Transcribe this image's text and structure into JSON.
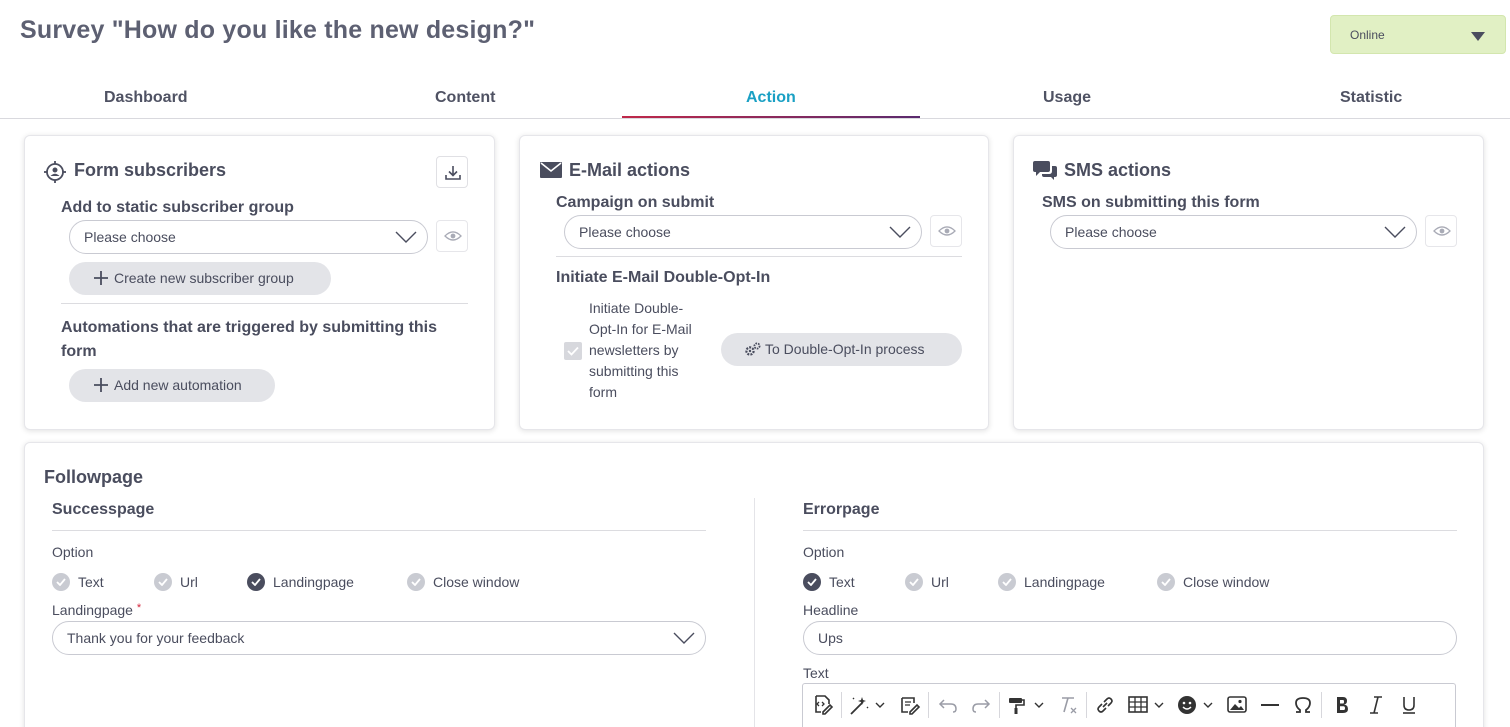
{
  "page": {
    "title": "Survey \"How do you like the new design?\""
  },
  "status": {
    "value": "Online"
  },
  "tabs": [
    {
      "label": "Dashboard"
    },
    {
      "label": "Content"
    },
    {
      "label": "Action"
    },
    {
      "label": "Usage"
    },
    {
      "label": "Statistic"
    }
  ],
  "form_subscribers": {
    "title": "Form subscribers",
    "group_label": "Add to static subscriber group",
    "group_select": "Please choose",
    "create_group_button": "Create new subscriber group",
    "automations_label": "Automations that are triggered by submitting this form",
    "add_automation_button": "Add new automation"
  },
  "email_actions": {
    "title": "E-Mail actions",
    "campaign_label": "Campaign on submit",
    "campaign_select": "Please choose",
    "doi_label": "Initiate E-Mail Double-Opt-In",
    "doi_checkbox_text": "Initiate Double-Opt-In for E-Mail newsletters by submitting this form",
    "doi_button": "To Double-Opt-In process"
  },
  "sms_actions": {
    "title": "SMS actions",
    "sms_label": "SMS on submitting this form",
    "sms_select": "Please choose"
  },
  "followpage": {
    "title": "Followpage",
    "success": {
      "title": "Successpage",
      "option_label": "Option",
      "options": [
        "Text",
        "Url",
        "Landingpage",
        "Close window"
      ],
      "selected": "Landingpage",
      "landingpage_label": "Landingpage",
      "required_mark": "*",
      "landingpage_value": "Thank you for your feedback"
    },
    "error": {
      "title": "Errorpage",
      "option_label": "Option",
      "options": [
        "Text",
        "Url",
        "Landingpage",
        "Close window"
      ],
      "selected": "Text",
      "headline_label": "Headline",
      "headline_value": "Ups",
      "text_label": "Text"
    }
  },
  "colors": {
    "accent": "#1aa0c4",
    "status_bg": "#e1f0c4",
    "tab_underline_start": "#c02849",
    "tab_underline_end": "#5a2a6e"
  }
}
